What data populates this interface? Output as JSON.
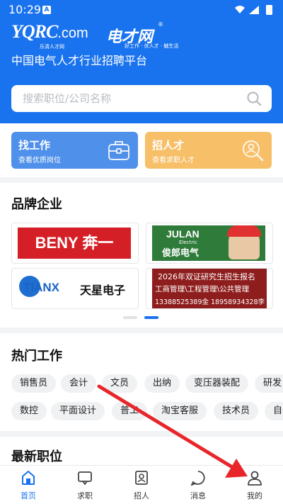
{
  "status_bar": {
    "time": "10:29",
    "badge": "A"
  },
  "header": {
    "logo_main": "YQRC",
    "logo_domain": ".com",
    "logo_sub": "乐清人才网",
    "logo_alt": "电才网",
    "logo_alt_sub": "好工作 · 优人才 · 触生活",
    "reg_mark": "®",
    "tagline": "中国电气人才行业招聘平台",
    "search_placeholder": "搜索职位/公司名称"
  },
  "cards": [
    {
      "title": "找工作",
      "subtitle": "查看优质岗位",
      "icon": "briefcase-icon"
    },
    {
      "title": "招人才",
      "subtitle": "查看求职人才",
      "icon": "talent-search-icon"
    }
  ],
  "brands": {
    "title": "品牌企业",
    "items": {
      "beny": "BENY 奔一",
      "julan_name": "JULAN",
      "julan_elec": "Electric",
      "julan_cn": "俊郎电气",
      "tianx_en": "TIANX",
      "tianx_cn": "天星电子",
      "ad_line1": "2026年双证研究生招生报名",
      "ad_line2": "工商管理\\工程管理\\公共管理",
      "ad_line3": "13388525389金  18958934328李"
    }
  },
  "hot_jobs": {
    "title": "热门工作",
    "row1": [
      "销售员",
      "会计",
      "文员",
      "出纳",
      "变压器装配",
      "研发"
    ],
    "row2": [
      "数控",
      "平面设计",
      "普工",
      "淘宝客服",
      "技术员",
      "自"
    ]
  },
  "latest": {
    "title": "最新职位"
  },
  "tabbar": [
    {
      "label": "首页",
      "icon": "home-icon",
      "active": true
    },
    {
      "label": "求职",
      "icon": "job-search-icon",
      "active": false
    },
    {
      "label": "招人",
      "icon": "recruit-icon",
      "active": false
    },
    {
      "label": "消息",
      "icon": "message-icon",
      "active": false
    },
    {
      "label": "我的",
      "icon": "profile-icon",
      "active": false
    }
  ],
  "colors": {
    "primary": "#1a73ee",
    "card_find": "#4f90ea",
    "card_hire": "#f7bf68",
    "annotation_arrow": "#e8262a"
  }
}
